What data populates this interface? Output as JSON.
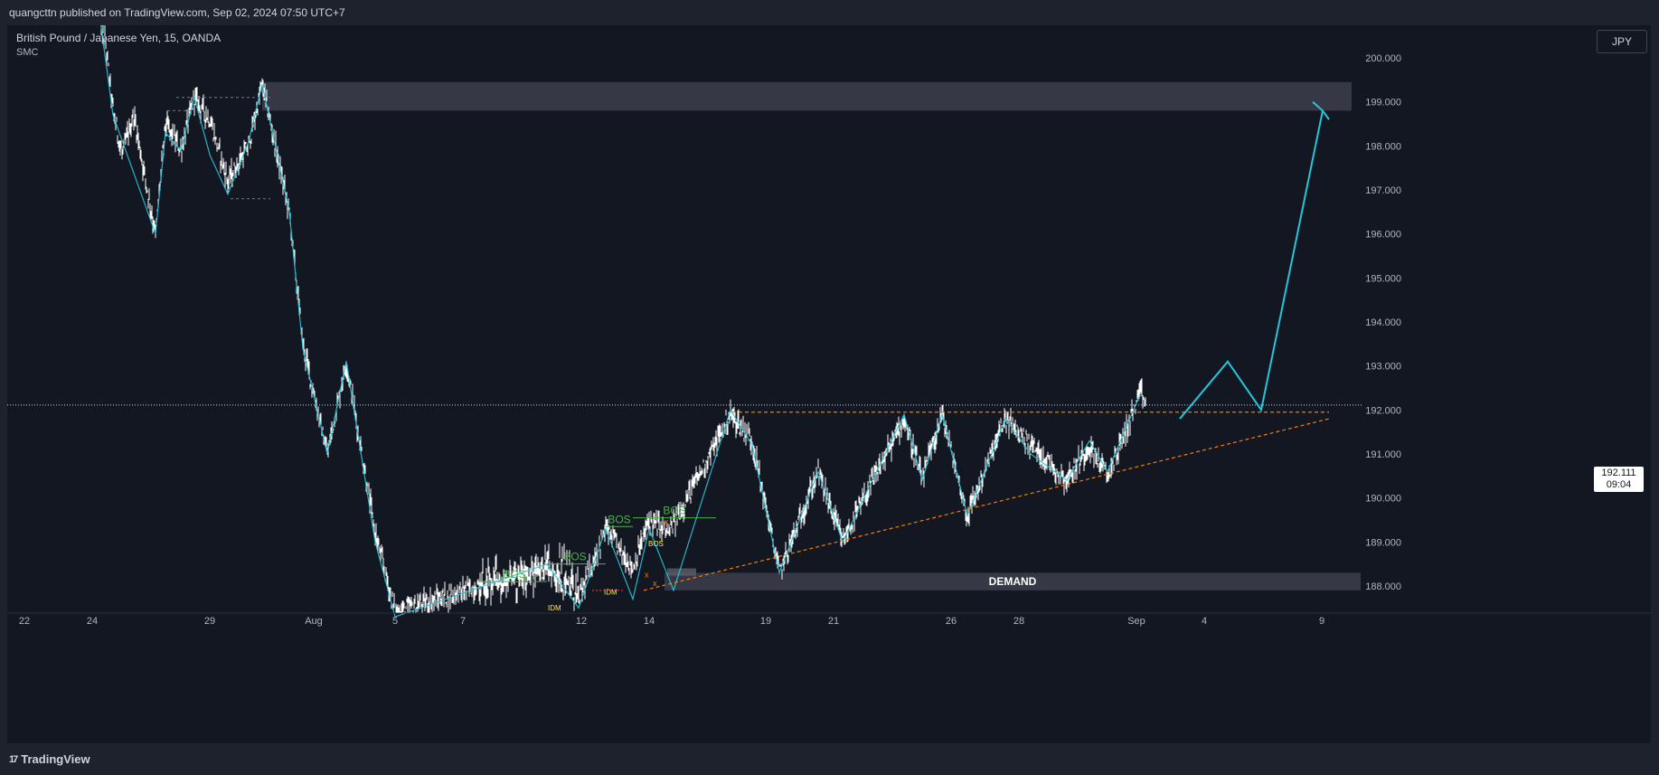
{
  "header": {
    "publish_line": "quangcttn published on TradingView.com, Sep 02, 2024 07:50 UTC+7"
  },
  "chart_header": {
    "symbol_title": "British Pound / Japanese Yen, 15, OANDA",
    "indicator": "SMC",
    "currency_button": "JPY"
  },
  "last_price": {
    "price": "192.111",
    "countdown": "09:04"
  },
  "footer": {
    "brand": "TradingView",
    "brand_icon": "tradingview-logo-icon"
  },
  "colors": {
    "background": "#131722",
    "candle": "#ffffff",
    "zigzag": "#26c6da",
    "bos": "#4caf50",
    "trendline": "#f57c00",
    "zone": "#434651",
    "axis_text": "#b2b5be"
  },
  "chart_data": {
    "type": "line",
    "title": "British Pound / Japanese Yen, 15, OANDA",
    "ylim": [
      187.4,
      200.8
    ],
    "y_ticks": [
      "200.000",
      "199.000",
      "198.000",
      "197.000",
      "196.000",
      "195.000",
      "194.000",
      "193.000",
      "192.000",
      "191.000",
      "190.000",
      "189.000",
      "188.000"
    ],
    "x_ticks": [
      "22",
      "24",
      "29",
      "Aug",
      "5",
      "7",
      "12",
      "14",
      "19",
      "21",
      "26",
      "28",
      "Sep",
      "4",
      "9"
    ],
    "price_path": [
      [
        "22",
        201.0
      ],
      [
        "24",
        200.3
      ],
      [
        "24",
        198.8
      ],
      [
        "24",
        197.8
      ],
      [
        "24",
        198.7
      ],
      [
        "24",
        196.0
      ],
      [
        "29",
        198.5
      ],
      [
        "29",
        197.9
      ],
      [
        "29",
        199.1
      ],
      [
        "29",
        198.6
      ],
      [
        "29",
        197.2
      ],
      [
        "29",
        198.0
      ],
      [
        "29",
        199.4
      ],
      [
        "Aug",
        196.5
      ],
      [
        "Aug",
        193.5
      ],
      [
        "Aug",
        191.0
      ],
      [
        "Aug",
        193.1
      ],
      [
        "Aug",
        189.2
      ],
      [
        "5",
        187.4
      ],
      [
        "7",
        188.0
      ],
      [
        "12",
        188.4
      ],
      [
        "12",
        187.7
      ],
      [
        "12",
        189.3
      ],
      [
        "14",
        188.4
      ],
      [
        "14",
        189.5
      ],
      [
        "14",
        189.2
      ],
      [
        "19",
        191.9
      ],
      [
        "19",
        191.3
      ],
      [
        "19",
        188.3
      ],
      [
        "21",
        190.6
      ],
      [
        "21",
        189.0
      ],
      [
        "26",
        191.8
      ],
      [
        "26",
        190.4
      ],
      [
        "26",
        191.9
      ],
      [
        "28",
        189.6
      ],
      [
        "28",
        191.8
      ],
      [
        "28",
        190.4
      ],
      [
        "Sep",
        191.2
      ],
      [
        "Sep",
        190.5
      ],
      [
        "Sep",
        192.4
      ],
      [
        "Sep",
        192.1
      ]
    ],
    "annotations": {
      "supply_zone": [
        198.8,
        199.45
      ],
      "demand_zone_label": "DEMAND",
      "demand_zone": [
        187.9,
        188.3
      ],
      "resistance_level": 191.95,
      "bos_labels": [
        "BOS",
        "BOS",
        "BOS",
        "BOS"
      ],
      "bos_levels": [
        188.1,
        188.5,
        189.35,
        189.55
      ],
      "idm_labels": [
        "IDM",
        "IDM",
        "BOS"
      ],
      "forecast_path": [
        192.0,
        193.1,
        192.0,
        198.8
      ],
      "last_price": 192.111
    }
  }
}
